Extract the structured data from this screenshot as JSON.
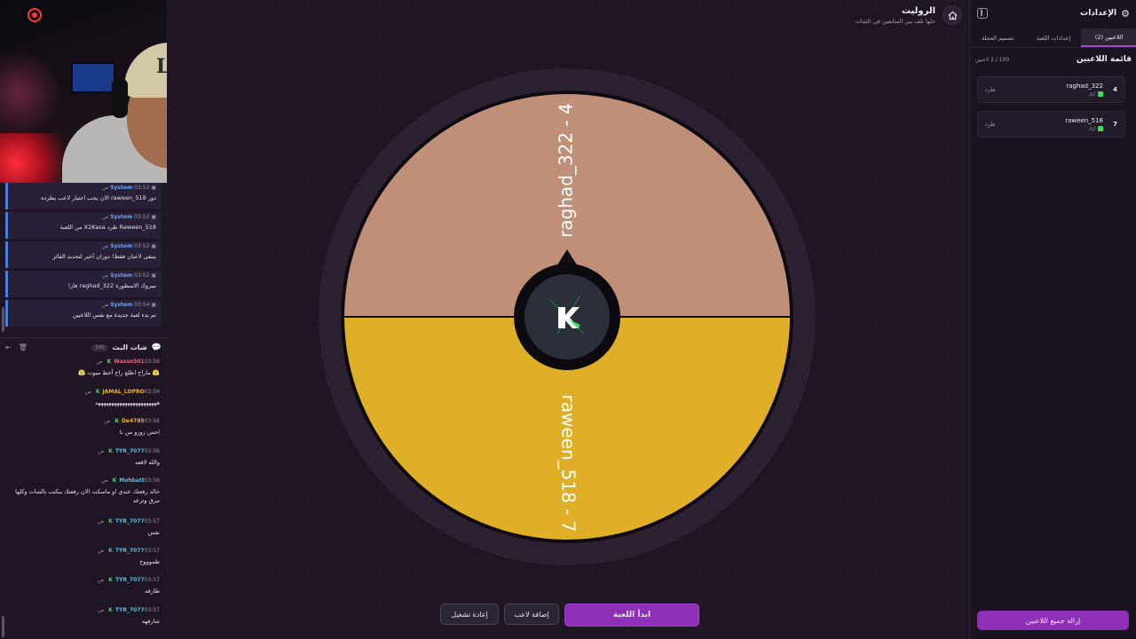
{
  "webcam": {
    "cap_logo": "LA"
  },
  "system_feed": [
    {
      "sender": "System",
      "time": "03:52 ص",
      "text": "دور raween_518 الان يجب اختيار لاعب يطرده"
    },
    {
      "sender": "System",
      "time": "03:52 ص",
      "text": "Raween_518 طرد X2Kasa من اللعبة"
    },
    {
      "sender": "System",
      "time": "03:52 ص",
      "text": "يتبقى لاعبان فقط! دوران أخير لتحديد الفائز"
    },
    {
      "sender": "System",
      "time": "03:52 ص",
      "text": "مبروك الاسطورة raghad_322 فاز!"
    },
    {
      "sender": "System",
      "time": "03:54 ص",
      "text": "تم بدء لعبة جديدة مع نفس اللاعبين"
    }
  ],
  "chat": {
    "title": "شات البث",
    "count": "100",
    "messages": [
      {
        "user": "Wassn501",
        "color": "#ff5c8a",
        "time": "03:56 ص",
        "text": "😤 ماراح اطلع راح أخط ميوت 😤"
      },
      {
        "user": "JAMAL_LOPRO",
        "color": "#f0b429",
        "time": "03:56 ص",
        "text": "هههههههههههههههههههههههه"
      },
      {
        "user": "De4785",
        "color": "#f0b429",
        "time": "03:56 ص",
        "text": "احس زورو من نا"
      },
      {
        "user": "TYR_7077",
        "color": "#4ec3e0",
        "time": "03:56 ص",
        "text": "والله لاقعد"
      },
      {
        "user": "Mohbatt",
        "color": "#4ec3e0",
        "time": "03:56 ص",
        "text": "خالد رفعتك عندي او ماسكت الان رفعتك ينكتب بالشات وكلها تبرق وترعد"
      },
      {
        "user": "TYR_7077",
        "color": "#4ec3e0",
        "time": "03:57 ص",
        "text": "نفس"
      },
      {
        "user": "TYR_7077",
        "color": "#4ec3e0",
        "time": "03:57 ص",
        "text": "طموووح"
      },
      {
        "user": "TYR_7077",
        "color": "#4ec3e0",
        "time": "03:57 ص",
        "text": "طارقه"
      },
      {
        "user": "TYR_7077",
        "color": "#4ec3e0",
        "time": "03:57 ص",
        "text": "شارقهه"
      }
    ]
  },
  "header": {
    "title": "الروليت",
    "subtitle": "خلها تلف بين المتابعين في الشات"
  },
  "wheel": {
    "segments": [
      {
        "label": "raghad_322 - 4",
        "color": "#bf8f78"
      },
      {
        "label": "raween_518 - 7",
        "color": "#dfb027"
      }
    ]
  },
  "controls": {
    "restart": "إعادة تشغيل",
    "add_player": "إضافة لاعب",
    "start": "ابدأ اللعبة"
  },
  "panel": {
    "title": "الإعدادات",
    "tabs": [
      "اللاعبين (2)",
      "إعدادات اللعبة",
      "تصميم العجلة"
    ],
    "players_title": "قائمة اللاعبين",
    "players_count": "100 / 2 لاعبين",
    "players": [
      {
        "number": "4",
        "name": "raghad_322",
        "platform": "كيك",
        "kick": "طرد"
      },
      {
        "number": "7",
        "name": "raween_518",
        "platform": "كيك",
        "kick": "طرد"
      }
    ],
    "remove_all": "إزالة جميع اللاعبين"
  }
}
